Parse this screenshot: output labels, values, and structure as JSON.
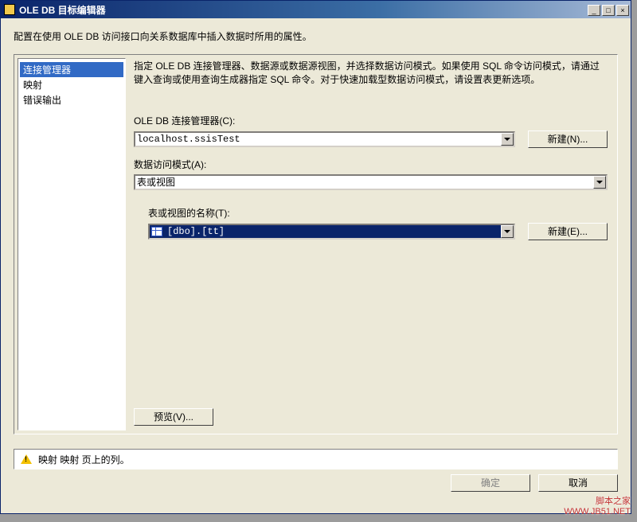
{
  "titlebar": {
    "title": "OLE DB 目标编辑器"
  },
  "description": "配置在使用 OLE DB 访问接口向关系数据库中插入数据时所用的属性。",
  "sidebar": {
    "items": [
      {
        "label": "连接管理器",
        "selected": true
      },
      {
        "label": "映射",
        "selected": false
      },
      {
        "label": "错误输出",
        "selected": false
      }
    ]
  },
  "instruction": "指定 OLE DB 连接管理器、数据源或数据源视图，并选择数据访问模式。如果使用 SQL 命令访问模式，请通过键入查询或使用查询生成器指定 SQL 命令。对于快速加载型数据访问模式，请设置表更新选项。",
  "fields": {
    "connection_label": "OLE DB 连接管理器(C):",
    "connection_value": "localhost.ssisTest",
    "new_button": "新建(N)...",
    "access_mode_label": "数据访问模式(A):",
    "access_mode_value": "表或视图",
    "table_name_label": "表或视图的名称(T):",
    "table_name_value": "[dbo].[tt]",
    "new_button2": "新建(E)...",
    "preview_button": "预览(V)..."
  },
  "warning": "映射 映射 页上的列。",
  "footer": {
    "ok": "确定",
    "cancel": "取消"
  },
  "watermark": {
    "line1": "脚本之家",
    "line2": "WWW.JB51.NET"
  }
}
